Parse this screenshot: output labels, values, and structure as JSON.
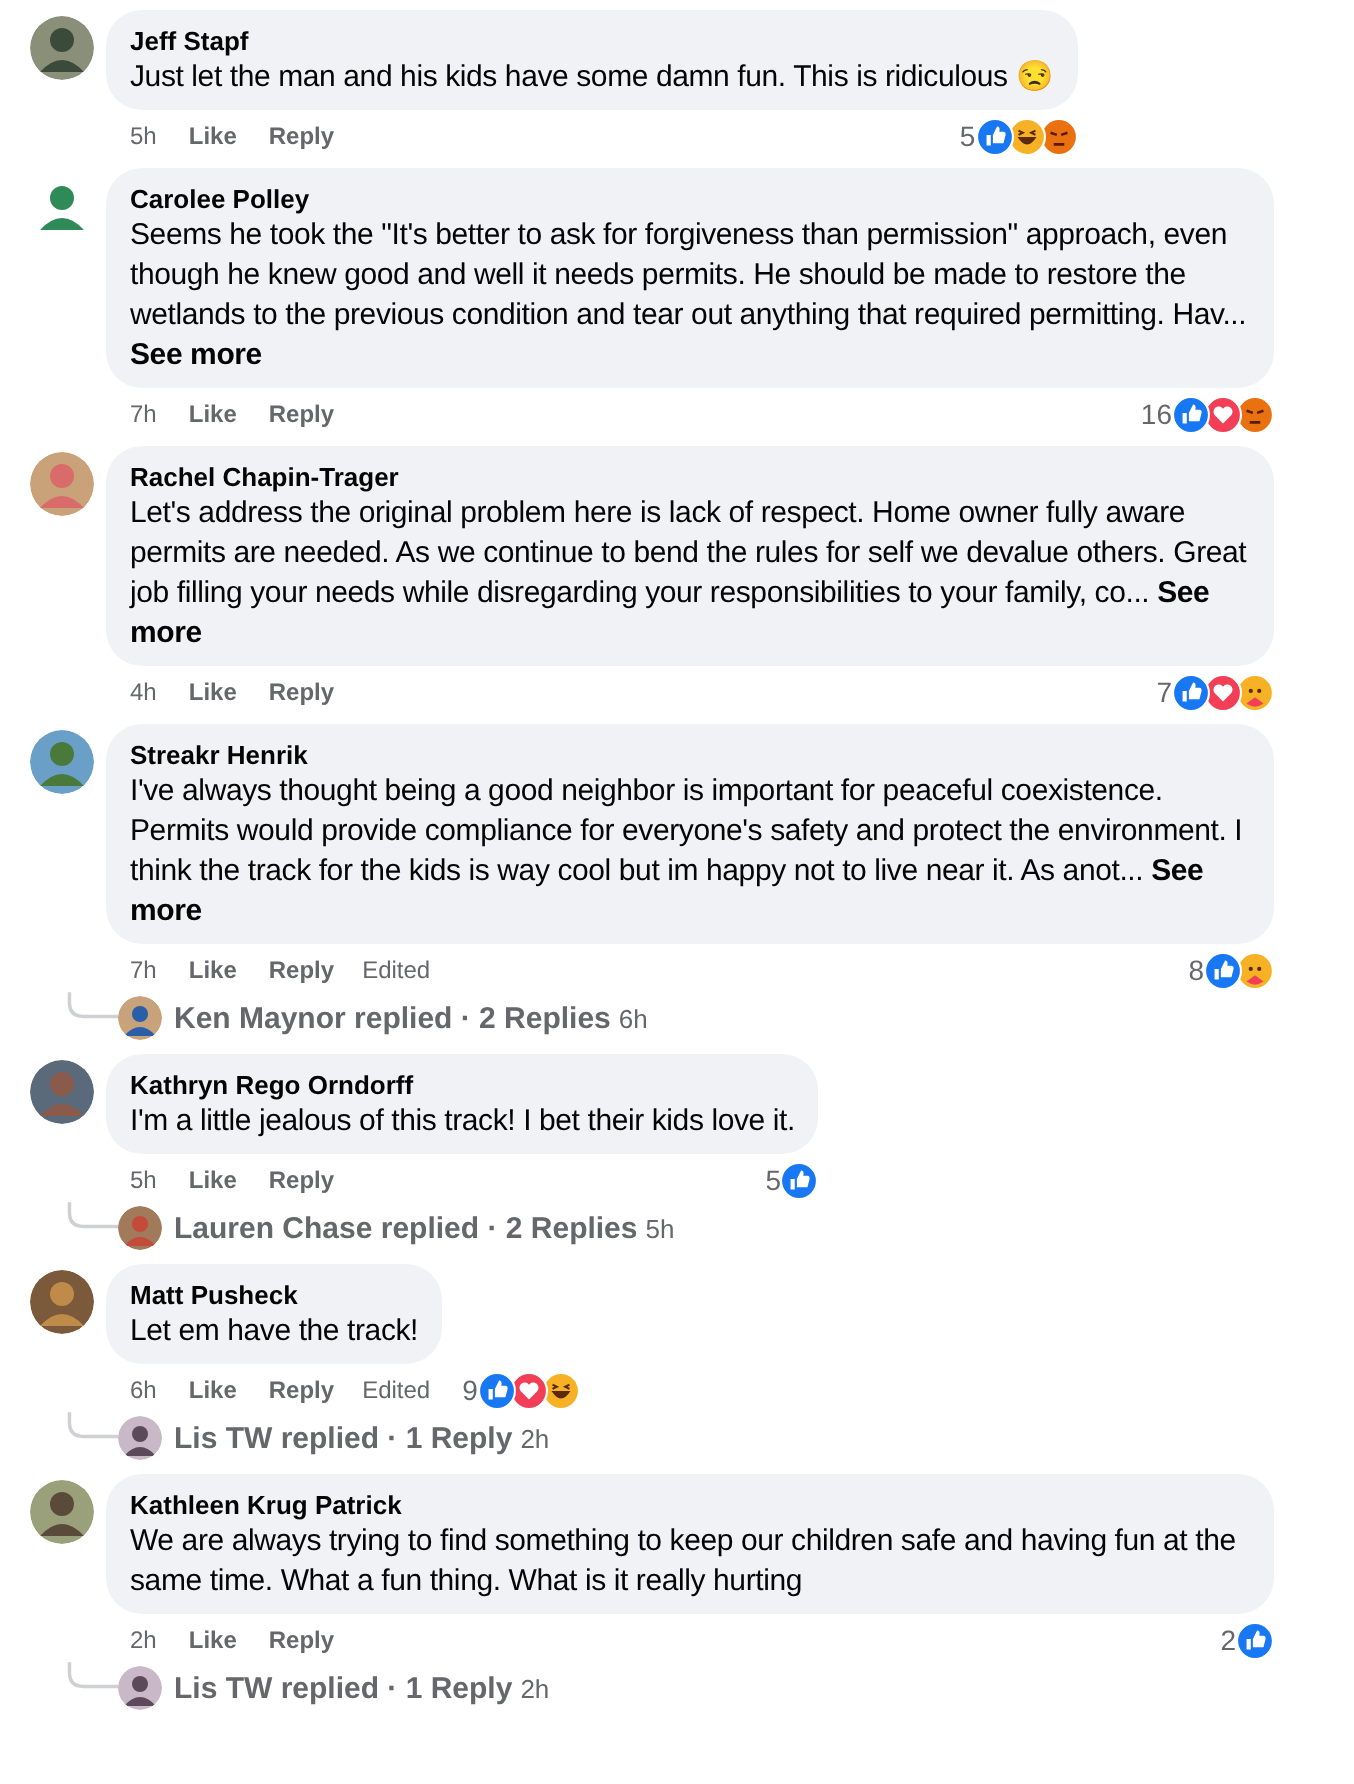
{
  "comments": [
    {
      "author": "Jeff Stapf",
      "text": "Just let the man and his kids have some damn fun. This is ridiculous 😒",
      "time": "5h",
      "actions": [
        "Like",
        "Reply"
      ],
      "reaction_count": "5",
      "reactions": [
        {
          "kind": "like"
        },
        {
          "kind": "haha"
        },
        {
          "kind": "angry"
        }
      ]
    },
    {
      "author": "Carolee Polley",
      "text": "Seems he took the \"It's better to ask for forgiveness than permission\" approach, even though he knew good and well it needs permits. He should be made to restore the wetlands to the previous condition and tear out anything that required permitting. Hav... **See more**",
      "time": "7h",
      "actions": [
        "Like",
        "Reply"
      ],
      "reaction_count": "16",
      "reactions": [
        {
          "kind": "like"
        },
        {
          "kind": "love"
        },
        {
          "kind": "angry"
        }
      ]
    },
    {
      "author": "Rachel Chapin-Trager",
      "text": "Let's address the original problem here is lack of respect. Home owner fully aware permits are needed. As we continue to bend the rules for self we devalue others. Great job filling your needs while disregarding your responsibilities to your family, co... **See more**",
      "time": "4h",
      "actions": [
        "Like",
        "Reply"
      ],
      "reaction_count": "7",
      "reactions": [
        {
          "kind": "like"
        },
        {
          "kind": "love"
        },
        {
          "kind": "care"
        }
      ]
    },
    {
      "author": "Streakr Henrik",
      "text": "I've always thought being a good neighbor is important for peaceful coexistence. Permits would provide compliance for everyone's safety and protect the environment. I think the track for the kids is way cool but im happy not to live near it. As anot... **See more**",
      "time": "7h",
      "actions": [
        "Like",
        "Reply"
      ],
      "edited_label": "Edited",
      "reaction_count": "8",
      "reactions": [
        {
          "kind": "like"
        },
        {
          "kind": "care"
        }
      ],
      "replies": {
        "summary": "Ken Maynor replied · 2 Replies",
        "time": "6h"
      }
    },
    {
      "author": "Kathryn Rego Orndorff",
      "text": "I'm a little jealous of this track! I bet their kids love it.",
      "time": "5h",
      "actions": [
        "Like",
        "Reply"
      ],
      "reaction_count": "5",
      "reactions": [
        {
          "kind": "like"
        }
      ],
      "replies": {
        "summary": "Lauren Chase replied · 2 Replies",
        "time": "5h"
      }
    },
    {
      "author": "Matt Pusheck",
      "text": "Let em have the track!",
      "time": "6h",
      "actions": [
        "Like",
        "Reply"
      ],
      "edited_label": "Edited",
      "reaction_count": "9",
      "reactions": [
        {
          "kind": "like"
        },
        {
          "kind": "love"
        },
        {
          "kind": "haha"
        }
      ],
      "replies": {
        "summary": "Lis TW replied · 1 Reply",
        "time": "2h"
      }
    },
    {
      "author": "Kathleen Krug Patrick",
      "text": "We are always trying to find something to keep our children safe and having fun at the same time. What a fun thing. What is it really hurting",
      "time": "2h",
      "actions": [
        "Like",
        "Reply"
      ],
      "reaction_count": "2",
      "reactions": [
        {
          "kind": "like"
        }
      ],
      "replies": {
        "summary": "Lis TW replied · 1 Reply",
        "time": "2h"
      }
    }
  ]
}
